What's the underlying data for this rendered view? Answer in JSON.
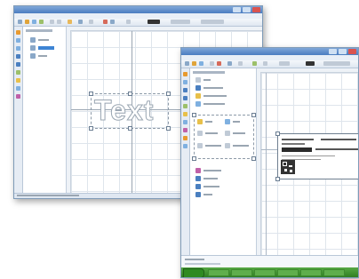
{
  "back_window": {
    "canvas_text": "Text"
  },
  "colors": {
    "title_blue": "#4b7dc0",
    "taskbar_green": "#3c8f2c",
    "start_green": "#2f8a22"
  },
  "icons": [
    "minimize-icon",
    "maximize-icon",
    "close-icon",
    "toolbar-icon",
    "tool-icon",
    "tree-node-icon",
    "qr-code-icon",
    "start-button-icon"
  ]
}
